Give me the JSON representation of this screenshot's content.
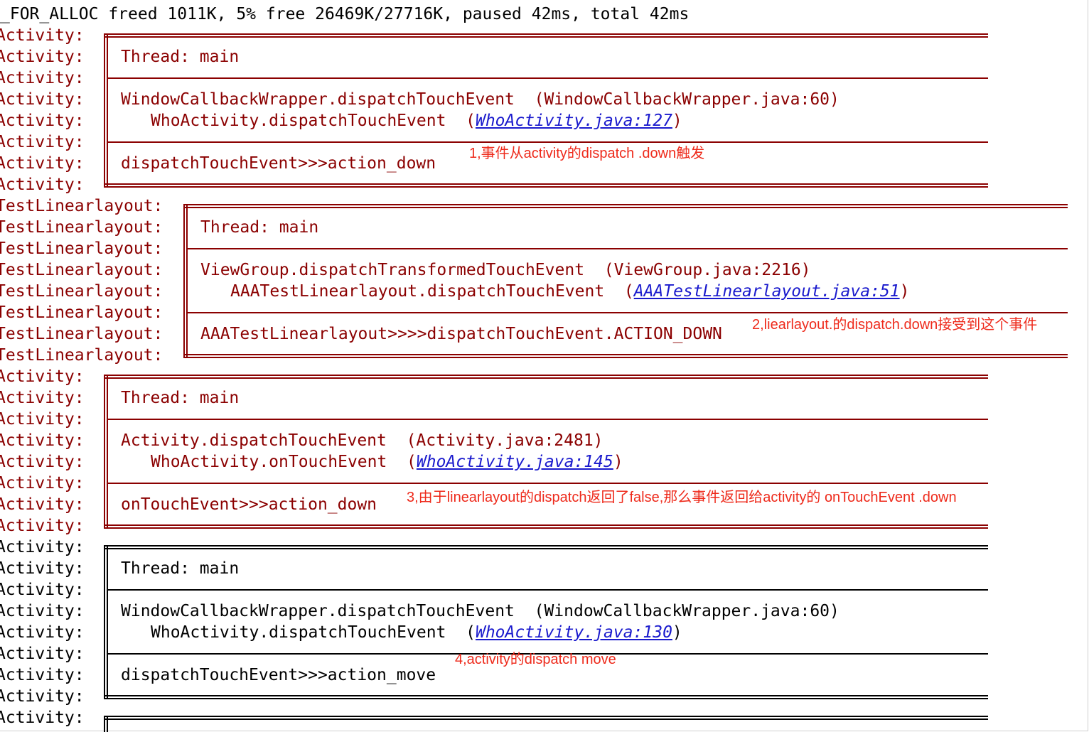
{
  "header_line": "_FOR_ALLOC freed 1011K, 5% free 26469K/27716K, paused 42ms, total 42ms",
  "tags": {
    "activity": "Activity:",
    "layout": "TestLinearlayout:"
  },
  "tag_rows": [
    "Activity:",
    "Activity:",
    "Activity:",
    "Activity:",
    "Activity:",
    "Activity:",
    "Activity:",
    "Activity:",
    "TestLinearlayout:",
    "TestLinearlayout:",
    "TestLinearlayout:",
    "TestLinearlayout:",
    "TestLinearlayout:",
    "TestLinearlayout:",
    "TestLinearlayout:",
    "TestLinearlayout:",
    "Activity:",
    "Activity:",
    "Activity:",
    "Activity:",
    "Activity:",
    "Activity:",
    "Activity:",
    "Activity:",
    "Activity:",
    "Activity:",
    "Activity:",
    "Activity:",
    "Activity:",
    "Activity:",
    "Activity:",
    "Activity:",
    "Activity:"
  ],
  "boxes": [
    {
      "thread": "Thread: main",
      "frame1_method": "WindowCallbackWrapper.dispatchTouchEvent",
      "frame1_loc": "(WindowCallbackWrapper.java:60)",
      "frame2_method": "WhoActivity.dispatchTouchEvent",
      "frame2_link": "WhoActivity.java:127",
      "message": "dispatchTouchEvent>>>action_down",
      "note": "1,事件从activity的dispatch .down触发"
    },
    {
      "thread": "Thread: main",
      "frame1_method": "ViewGroup.dispatchTransformedTouchEvent",
      "frame1_loc": "(ViewGroup.java:2216)",
      "frame2_method": "AAATestLinearlayout.dispatchTouchEvent",
      "frame2_link": "AAATestLinearlayout.java:51",
      "message": "AAATestLinearlayout>>>>dispatchTouchEvent.ACTION_DOWN",
      "note": "2,liearlayout.的dispatch.down接受到这个事件"
    },
    {
      "thread": "Thread: main",
      "frame1_method": "Activity.dispatchTouchEvent",
      "frame1_loc": "(Activity.java:2481)",
      "frame2_method": "WhoActivity.onTouchEvent",
      "frame2_link": "WhoActivity.java:145",
      "message": "onTouchEvent>>>action_down",
      "note": "3,由于linearlayout的dispatch返回了false,那么事件返回给activity的 onTouchEvent .down"
    },
    {
      "thread": "Thread: main",
      "frame1_method": "WindowCallbackWrapper.dispatchTouchEvent",
      "frame1_loc": "(WindowCallbackWrapper.java:60)",
      "frame2_method": "WhoActivity.dispatchTouchEvent",
      "frame2_link": "WhoActivity.java:130",
      "message": "dispatchTouchEvent>>>action_move",
      "note": "4,activity的dispatch move"
    }
  ],
  "colors": {
    "log_red": "#8b0000",
    "log_black": "#000000",
    "annotation": "#ee2a1b",
    "link": "#1a1acd"
  }
}
